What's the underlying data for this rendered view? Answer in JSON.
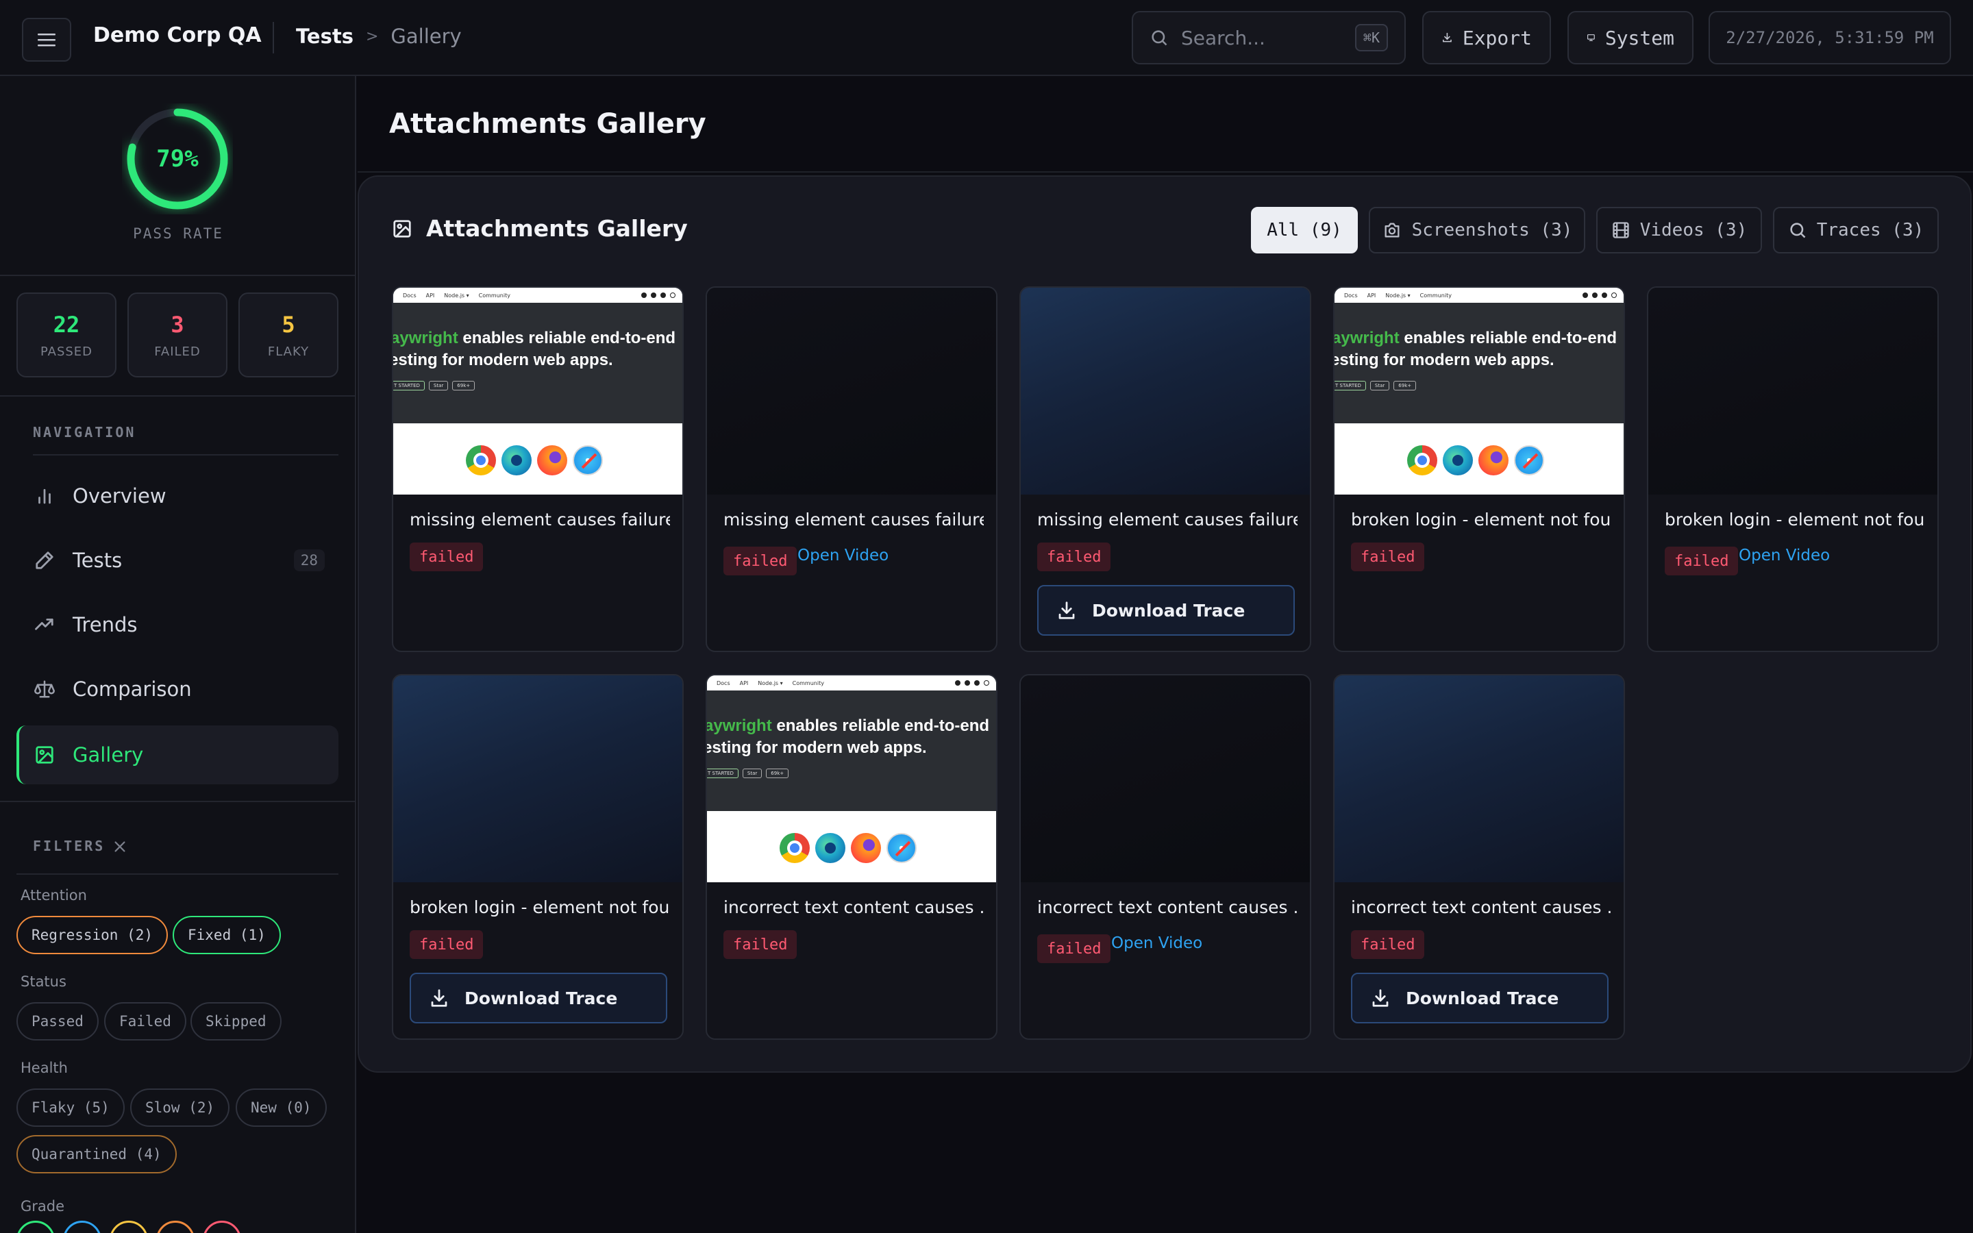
{
  "header": {
    "brand": "Demo Corp QA",
    "breadcrumb": {
      "root": "Tests",
      "separator": ">",
      "current": "Gallery"
    },
    "search": {
      "placeholder": "Search...",
      "shortcut": "⌘K"
    },
    "export_label": "Export",
    "theme_label": "System",
    "datetime": "2/27/2026, 5:31:59 PM"
  },
  "sidebar": {
    "pass_rate": {
      "value": "79%",
      "fraction": 0.79,
      "label": "PASS RATE"
    },
    "stats": [
      {
        "value": "22",
        "label": "PASSED",
        "color": "#2ee87a"
      },
      {
        "value": "3",
        "label": "FAILED",
        "color": "#ff5a72"
      },
      {
        "value": "5",
        "label": "FLAKY",
        "color": "#f5c542"
      }
    ],
    "nav_title": "NAVIGATION",
    "nav": [
      {
        "label": "Overview",
        "icon": "bar-chart-icon"
      },
      {
        "label": "Tests",
        "icon": "pencil-icon",
        "count": "28"
      },
      {
        "label": "Trends",
        "icon": "trend-up-icon"
      },
      {
        "label": "Comparison",
        "icon": "scale-icon"
      },
      {
        "label": "Gallery",
        "icon": "image-icon",
        "active": true
      }
    ],
    "filters": {
      "title": "FILTERS",
      "attention": {
        "label": "Attention",
        "chips": [
          "Regression (2)",
          "Fixed (1)"
        ]
      },
      "status": {
        "label": "Status",
        "chips": [
          "Passed",
          "Failed",
          "Skipped"
        ]
      },
      "health": {
        "label": "Health",
        "chips": [
          "Flaky (5)",
          "Slow (2)",
          "New (0)",
          "Quarantined (4)"
        ]
      },
      "grade": {
        "label": "Grade"
      }
    }
  },
  "main": {
    "page_title": "Attachments Gallery",
    "panel_title": "Attachments Gallery",
    "tabs": [
      {
        "label": "All (9)",
        "icon": "",
        "active": true
      },
      {
        "label": "Screenshots (3)",
        "icon": "camera-icon"
      },
      {
        "label": "Videos (3)",
        "icon": "film-icon"
      },
      {
        "label": "Traces (3)",
        "icon": "search-icon"
      }
    ],
    "pw_preview": {
      "nav": [
        "Docs",
        "API",
        "Node.js ▾",
        "Community"
      ],
      "line1_green": "aywright",
      "line1_rest": " enables reliable end-to-end",
      "line2": "esting for modern web apps.",
      "btn1": "T STARTED",
      "btn2": "Star",
      "btn3": "69k+"
    },
    "cards": [
      {
        "title": "missing element causes failure",
        "status": "failed",
        "kind": "screenshot"
      },
      {
        "title": "missing element causes failure",
        "status": "failed",
        "kind": "video",
        "action": "Open Video"
      },
      {
        "title": "missing element causes failure",
        "status": "failed",
        "kind": "trace",
        "action": "Download Trace"
      },
      {
        "title": "broken login - element not fou...",
        "status": "failed",
        "kind": "screenshot"
      },
      {
        "title": "broken login - element not fou...",
        "status": "failed",
        "kind": "video",
        "action": "Open Video"
      },
      {
        "title": "broken login - element not fou...",
        "status": "failed",
        "kind": "trace",
        "action": "Download Trace"
      },
      {
        "title": "incorrect text content causes ...",
        "status": "failed",
        "kind": "screenshot"
      },
      {
        "title": "incorrect text content causes ...",
        "status": "failed",
        "kind": "video",
        "action": "Open Video"
      },
      {
        "title": "incorrect text content causes ...",
        "status": "failed",
        "kind": "trace",
        "action": "Download Trace"
      }
    ]
  },
  "colors": {
    "accent_green": "#2ee87a",
    "failed_red": "#ff5a72",
    "flaky_yellow": "#f5c542",
    "link_blue": "#2ea3f2"
  }
}
